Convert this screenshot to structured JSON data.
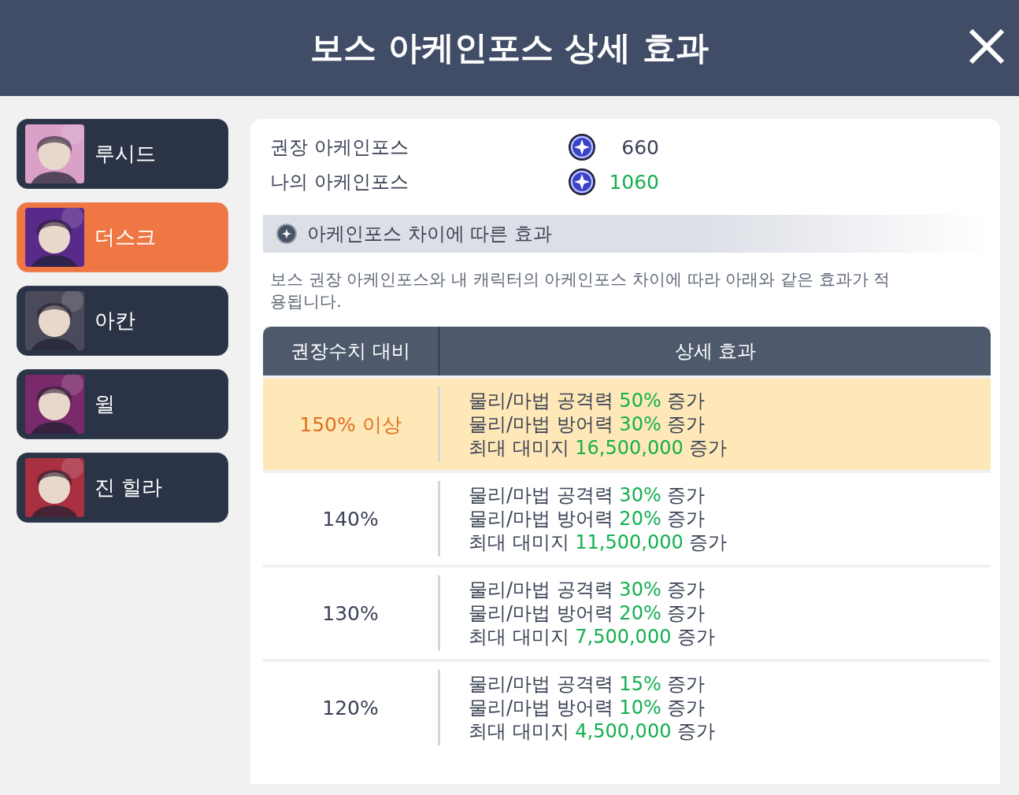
{
  "window": {
    "title": "보스 아케인포스 상세 효과"
  },
  "sidebar": {
    "items": [
      {
        "label": "루시드",
        "selected": false,
        "kind": "picture",
        "color": "#d9a0c8"
      },
      {
        "label": "더스크",
        "selected": true,
        "kind": "picture",
        "color": "#5a2a8a"
      },
      {
        "label": "아칸",
        "selected": false,
        "kind": "picture",
        "color": "#4a4a5a"
      },
      {
        "label": "윌",
        "selected": false,
        "kind": "picture",
        "color": "#7a2a6a"
      },
      {
        "label": "진 힐라",
        "selected": false,
        "kind": "picture",
        "color": "#a83040"
      }
    ]
  },
  "stats": [
    {
      "label": "권장 아케인포스",
      "value": "660",
      "met": false
    },
    {
      "label": "나의 아케인포스",
      "value": "1060",
      "met": true
    }
  ],
  "section": {
    "title": "아케인포스 차이에 따른 효과",
    "description": "보스 권장 아케인포스와 내 캐릭터의 아케인포스 차이에 따라 아래와 같은 효과가 적용됩니다."
  },
  "table": {
    "columns": [
      "권장수치 대비",
      "상세 효과"
    ],
    "rows": [
      {
        "ratio": "150% 이상",
        "highlighted": true,
        "effects": [
          {
            "text": "물리/마법 공격력",
            "value": "50%",
            "suffix": "증가"
          },
          {
            "text": "물리/마법 방어력",
            "value": "30%",
            "suffix": "증가"
          },
          {
            "text": "최대 대미지",
            "value": "16,500,000",
            "suffix": "증가"
          }
        ]
      },
      {
        "ratio": "140%",
        "highlighted": false,
        "effects": [
          {
            "text": "물리/마법 공격력",
            "value": "30%",
            "suffix": "증가"
          },
          {
            "text": "물리/마법 방어력",
            "value": "20%",
            "suffix": "증가"
          },
          {
            "text": "최대 대미지",
            "value": "11,500,000",
            "suffix": "증가"
          }
        ]
      },
      {
        "ratio": "130%",
        "highlighted": false,
        "effects": [
          {
            "text": "물리/마법 공격력",
            "value": "30%",
            "suffix": "증가"
          },
          {
            "text": "물리/마법 방어력",
            "value": "20%",
            "suffix": "증가"
          },
          {
            "text": "최대 대미지",
            "value": "7,500,000",
            "suffix": "증가"
          }
        ]
      },
      {
        "ratio": "120%",
        "highlighted": false,
        "effects": [
          {
            "text": "물리/마법 공격력",
            "value": "15%",
            "suffix": "증가"
          },
          {
            "text": "물리/마법 방어력",
            "value": "10%",
            "suffix": "증가"
          },
          {
            "text": "최대 대미지",
            "value": "4,500,000",
            "suffix": "증가"
          }
        ]
      }
    ]
  }
}
